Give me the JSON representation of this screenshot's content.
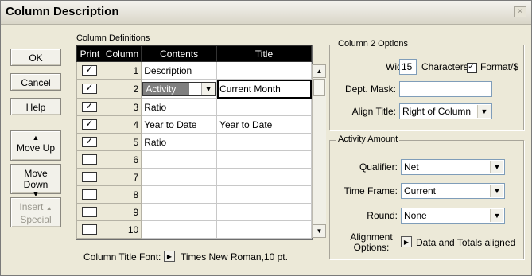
{
  "window": {
    "title": "Column Description",
    "close": "×"
  },
  "buttons": {
    "ok": "OK",
    "cancel": "Cancel",
    "help": "Help",
    "move_up": "Move Up",
    "move_down": "Move Down",
    "insert_special_1": "Insert",
    "insert_special_2": "Special"
  },
  "grid": {
    "group_label": "Column Definitions",
    "headers": [
      "Print",
      "Column",
      "Contents",
      "Title"
    ],
    "rows": [
      {
        "print": true,
        "column": "1",
        "contents": "Description",
        "title": ""
      },
      {
        "print": true,
        "column": "2",
        "contents": "Activity",
        "title": "Current Month"
      },
      {
        "print": true,
        "column": "3",
        "contents": "Ratio",
        "title": ""
      },
      {
        "print": true,
        "column": "4",
        "contents": "Year to Date",
        "title": "Year to Date"
      },
      {
        "print": true,
        "column": "5",
        "contents": "Ratio",
        "title": ""
      },
      {
        "print": false,
        "column": "6",
        "contents": "",
        "title": ""
      },
      {
        "print": false,
        "column": "7",
        "contents": "",
        "title": ""
      },
      {
        "print": false,
        "column": "8",
        "contents": "",
        "title": ""
      },
      {
        "print": false,
        "column": "9",
        "contents": "",
        "title": ""
      },
      {
        "print": false,
        "column": "10",
        "contents": "",
        "title": ""
      }
    ],
    "selected_row": 1
  },
  "font": {
    "label": "Column Title Font:",
    "value": "Times New Roman,10 pt."
  },
  "options2": {
    "title": "Column 2 Options",
    "width_label": "Width:",
    "width_value": "15",
    "characters_label": "Characters",
    "format_checked": true,
    "format_label": "Format/$",
    "dept_mask_label": "Dept. Mask:",
    "dept_mask_value": "",
    "align_title_label": "Align Title:",
    "align_title_value": "Right of Column"
  },
  "activity": {
    "title": "Activity Amount",
    "qualifier_label": "Qualifier:",
    "qualifier_value": "Net",
    "time_frame_label": "Time Frame:",
    "time_frame_value": "Current",
    "round_label": "Round:",
    "round_value": "None",
    "alignment_label_1": "Alignment",
    "alignment_label_2": "Options:",
    "alignment_value": "Data and Totals aligned"
  }
}
